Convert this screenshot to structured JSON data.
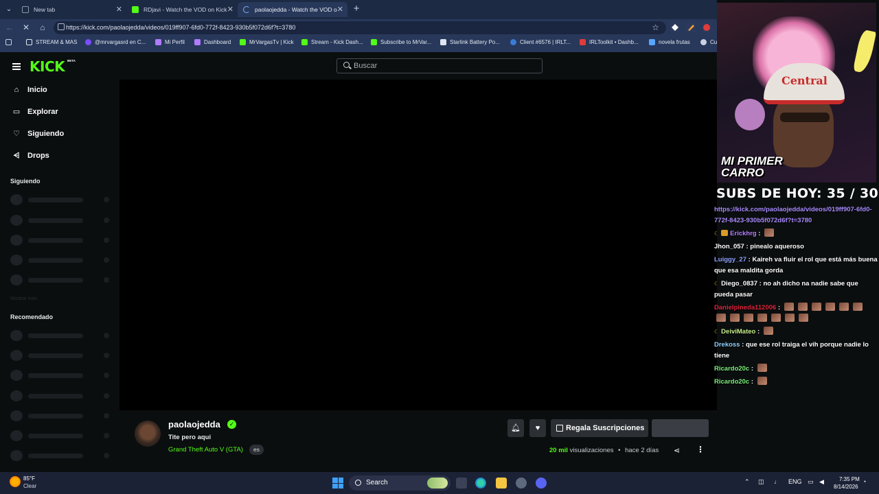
{
  "browser": {
    "tabs": [
      {
        "title": "New tab"
      },
      {
        "title": "RDjavi - Watch the VOD on Kick"
      },
      {
        "title": "paolaojedda - Watch the VOD on"
      }
    ],
    "url": "https://kick.com/paolaojedda/videos/019ff907-6fd0-772f-8423-930b5f072d6f?t=3780",
    "bookmarks": [
      {
        "label": "STREAM & MAS"
      },
      {
        "label": "@mrvargasrd en C..."
      },
      {
        "label": "Mi Perfil"
      },
      {
        "label": "Dashboard"
      },
      {
        "label": "MrVargasTv | Kick"
      },
      {
        "label": "Stream - Kick Dash..."
      },
      {
        "label": "Subscribe to MrVar..."
      },
      {
        "label": "Starlink Battery Po..."
      },
      {
        "label": "Client #6576 | IRLT..."
      },
      {
        "label": "IRLToolkit • Dashb..."
      },
      {
        "label": "novela frutas"
      },
      {
        "label": "Cu"
      }
    ]
  },
  "kick": {
    "logo": "KICK",
    "beta": "BETA",
    "search_placeholder": "Buscar",
    "nav": [
      {
        "label": "Inicio"
      },
      {
        "label": "Explorar"
      },
      {
        "label": "Siguiendo"
      },
      {
        "label": "Drops"
      }
    ],
    "sections": {
      "following": "Siguiendo",
      "recommended": "Recomendado",
      "show_more": "Mostrar más"
    },
    "channel": {
      "name": "paolaojedda",
      "title": "Tite pero aqui",
      "category": "Grand Theft Auto V (GTA)",
      "language": "es",
      "gift_label": "Regala Suscripciones",
      "views_count": "20 mil",
      "views_label": "visualizaciones",
      "separator": "•",
      "age": "hace 2 días"
    }
  },
  "overlay": {
    "cap_text": "Central",
    "caption": "MI PRIMER CARRO",
    "subs_goal": "SUBS DE HOY: 35 / 30"
  },
  "chat": {
    "link": "https://kick.com/paolaojedda/videos/019ff907-6fd0-772f-8423-930b5f072d6f?t=3780",
    "messages": [
      {
        "user": "Erickhrg",
        "text": ""
      },
      {
        "user": "Jhon_057",
        "text": "pinealo aqueroso"
      },
      {
        "user": "Luiggy_27",
        "text": "Kaireh va fluir el rol que está más buena que esa maldita gorda"
      },
      {
        "user": "Diego_0837",
        "text": "no ah dicho na nadie sabe que pueda pasar"
      },
      {
        "user": "Danielpineda112006",
        "text": ""
      },
      {
        "user": "DeiviMateo",
        "text": ""
      },
      {
        "user": "Drekoss",
        "text": "que ese rol traiga el vih porque nadie lo tiene"
      },
      {
        "user": "Ricardo20c",
        "text": ""
      },
      {
        "user": "Ricardo20c",
        "text": ""
      }
    ]
  },
  "taskbar": {
    "temp": "85°F",
    "condition": "Clear",
    "search": "Search",
    "lang": "ENG",
    "time": "7:35 PM",
    "date": "8/14/2026"
  },
  "colors": {
    "kick_green": "#53fc18",
    "chrome_tab_bg": "#1d2a44",
    "toolbar_bg": "#28385a",
    "page_bg": "#0b0e0f"
  }
}
